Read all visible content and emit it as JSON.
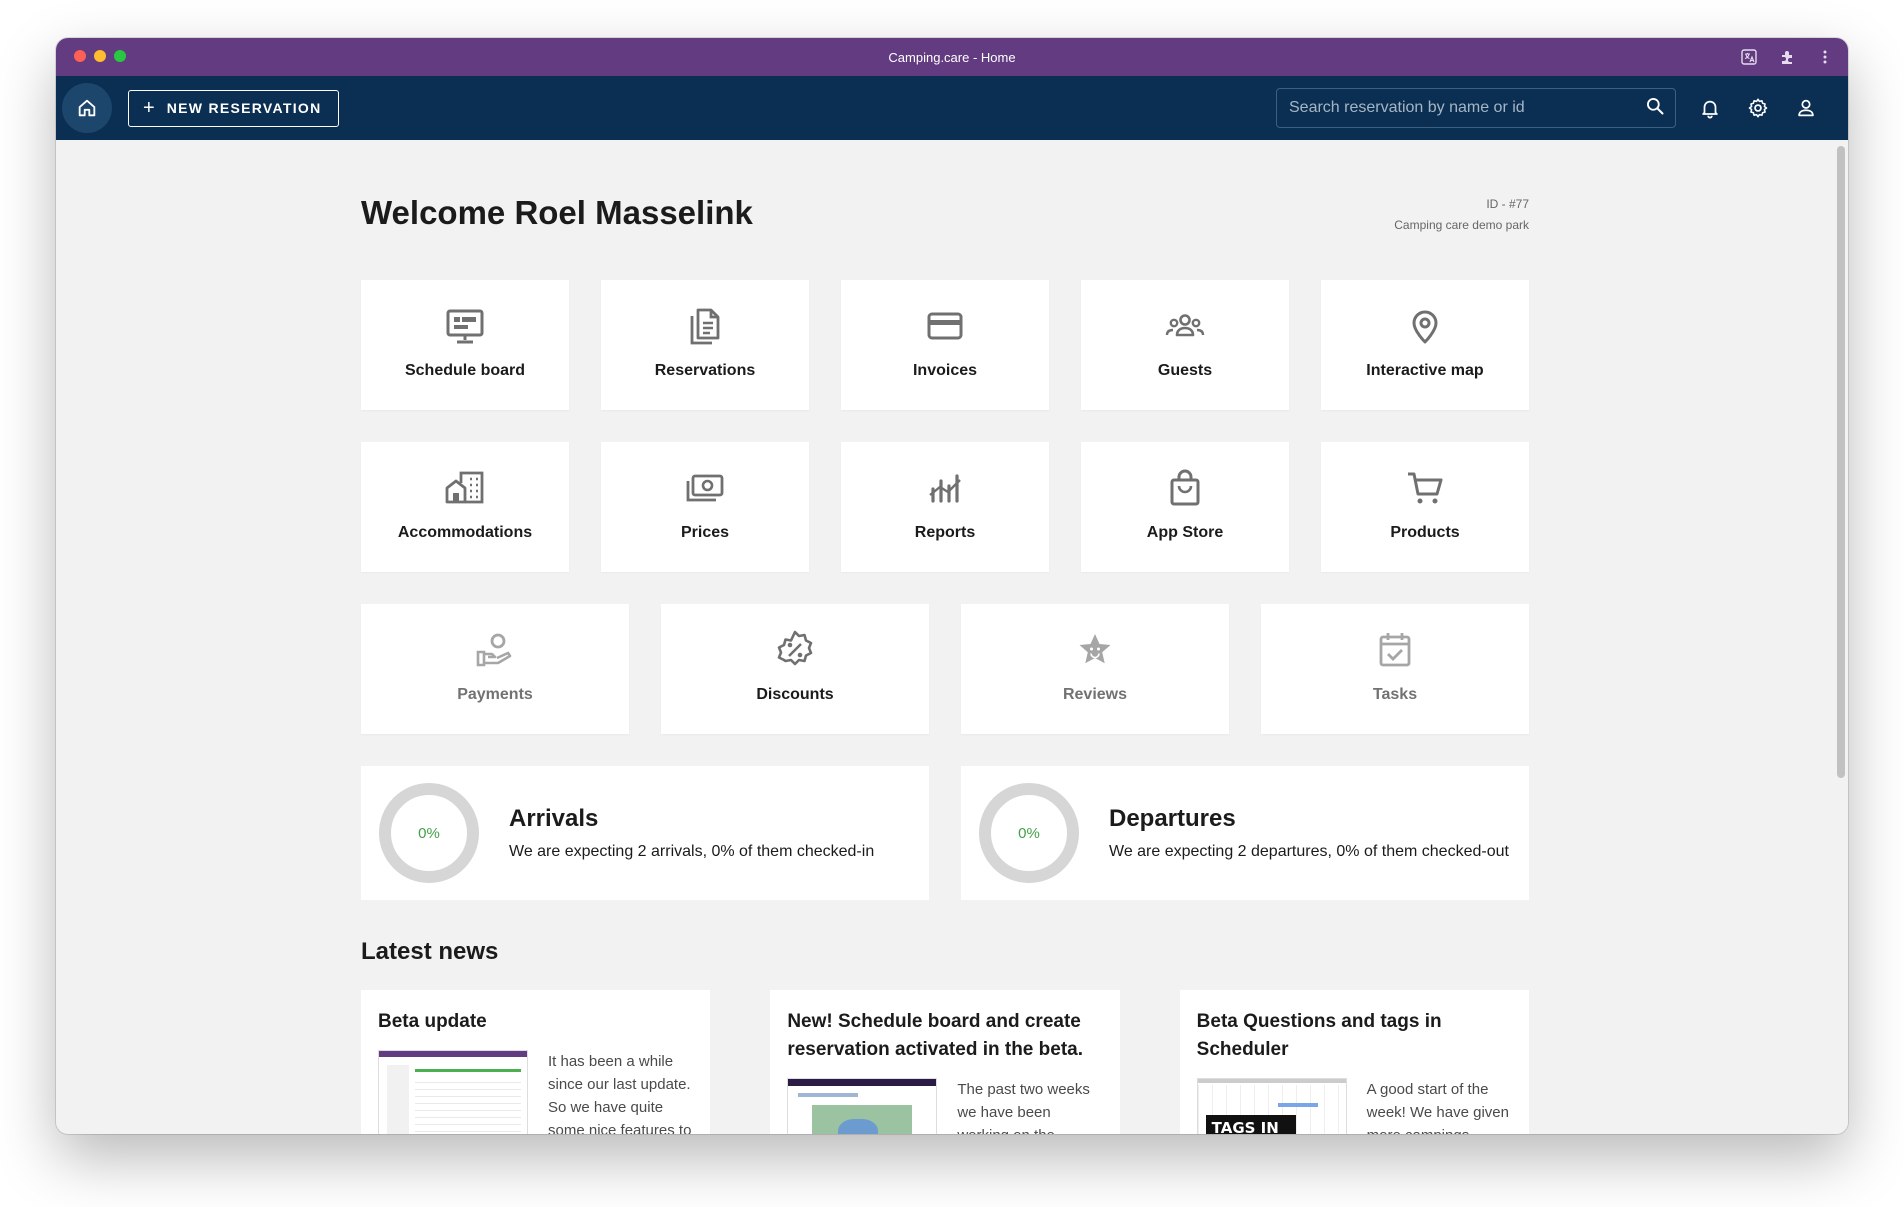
{
  "window": {
    "title": "Camping.care - Home"
  },
  "appbar": {
    "new_reservation_label": "NEW RESERVATION",
    "search_placeholder": "Search reservation by name or id"
  },
  "welcome": {
    "heading": "Welcome Roel Masselink",
    "id_line": "ID - #77",
    "park_name": "Camping care demo park"
  },
  "tiles": {
    "schedule_board": "Schedule board",
    "reservations": "Reservations",
    "invoices": "Invoices",
    "guests": "Guests",
    "interactive_map": "Interactive map",
    "accommodations": "Accommodations",
    "prices": "Prices",
    "reports": "Reports",
    "app_store": "App Store",
    "products": "Products",
    "payments": "Payments",
    "discounts": "Discounts",
    "reviews": "Reviews",
    "tasks": "Tasks"
  },
  "arrivals": {
    "title": "Arrivals",
    "percent": "0%",
    "description": "We are expecting 2 arrivals, 0% of them checked-in"
  },
  "departures": {
    "title": "Departures",
    "percent": "0%",
    "description": "We are expecting 2 departures, 0% of them checked-out"
  },
  "news": {
    "heading": "Latest news",
    "items": [
      {
        "title": "Beta update",
        "excerpt": "It has been a while since our last update. So we have quite some nice features to share"
      },
      {
        "title": "New! Schedule board and create reservation activated in the beta.",
        "excerpt": "The past two weeks we have been working on the"
      },
      {
        "title": "Beta Questions and tags in Scheduler",
        "excerpt": "A good start of the week! We have given more campings access to the BETA program. The",
        "thumb_text": "TAGS IN THE SCHEDULER"
      }
    ]
  },
  "colors": {
    "titlebar": "#633b80",
    "appbar": "#0b2f52",
    "background": "#f2f2f2",
    "progress_text": "#43a047",
    "ring": "#d6d6d6"
  }
}
